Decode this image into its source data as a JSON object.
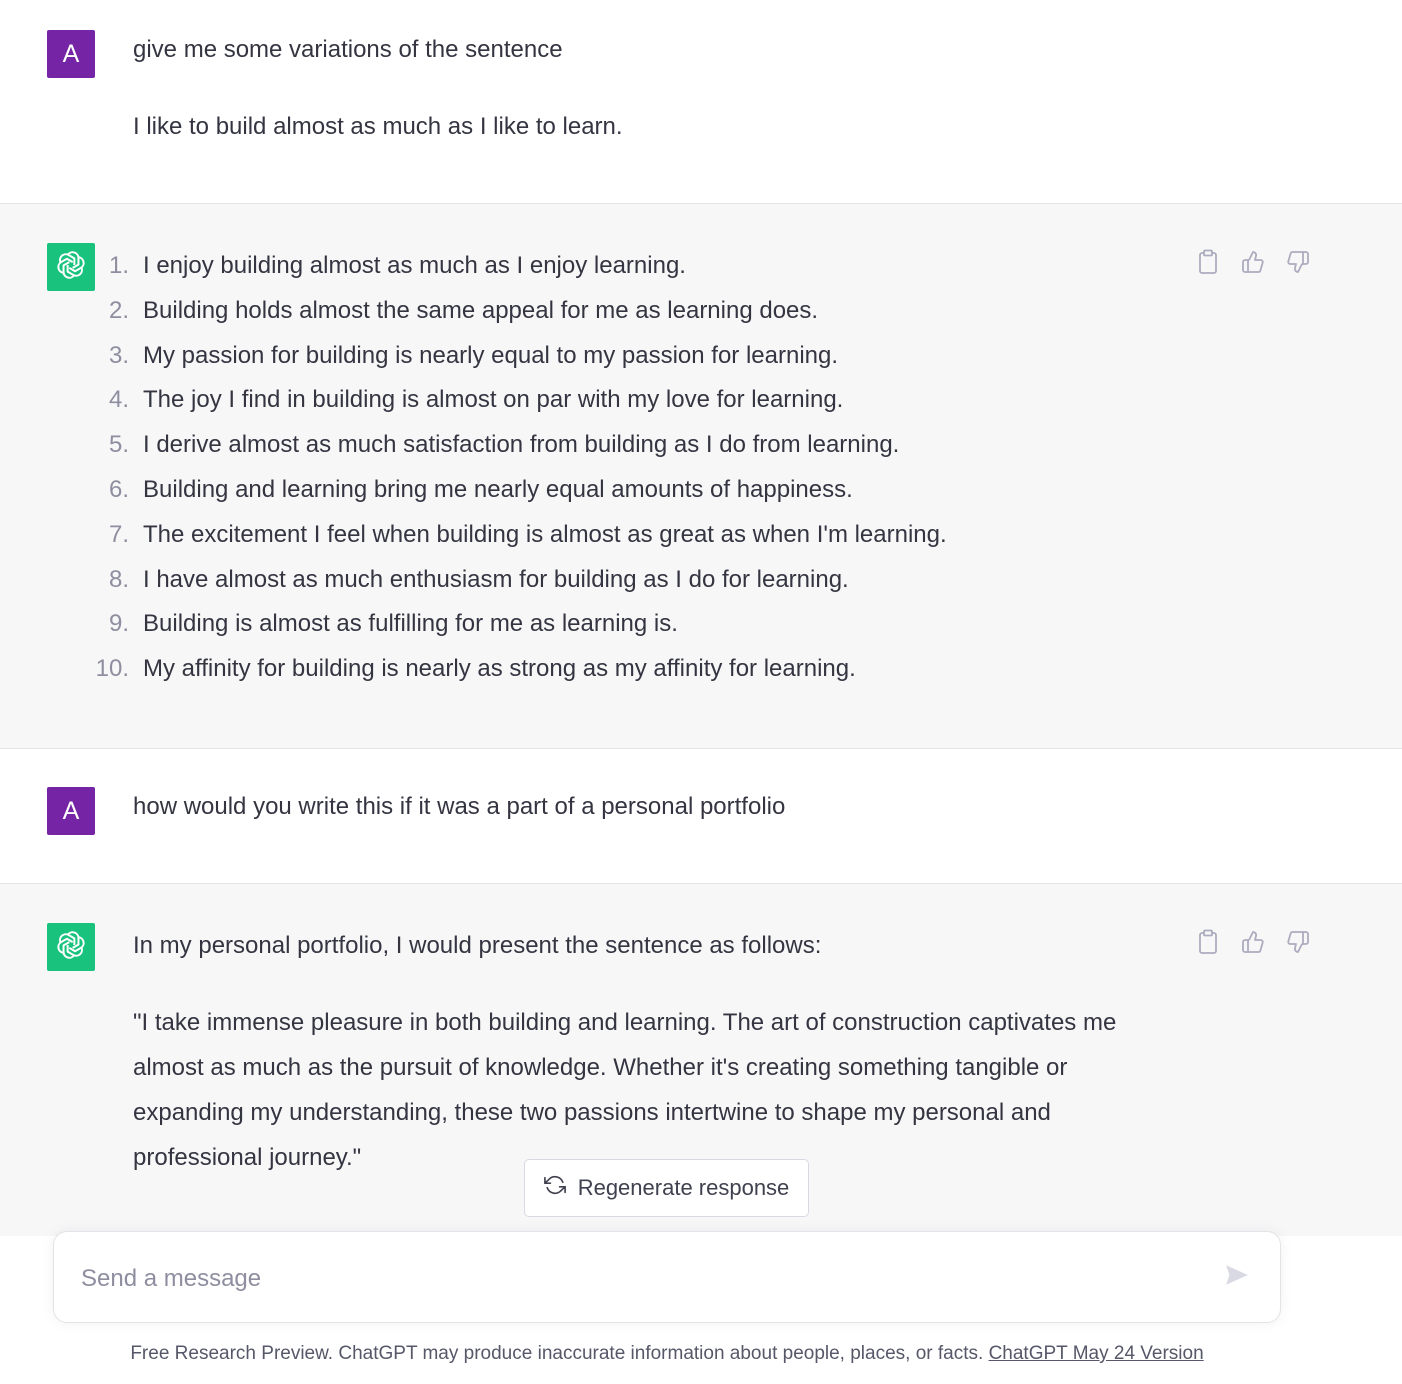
{
  "conversation": {
    "msg1": {
      "avatar_letter": "A",
      "line1": "give me some variations of the sentence",
      "line2": "I like to build almost as much as I like to learn."
    },
    "msg2": {
      "items": [
        {
          "num": "1.",
          "text": "I enjoy building almost as much as I enjoy learning."
        },
        {
          "num": "2.",
          "text": "Building holds almost the same appeal for me as learning does."
        },
        {
          "num": "3.",
          "text": "My passion for building is nearly equal to my passion for learning."
        },
        {
          "num": "4.",
          "text": "The joy I find in building is almost on par with my love for learning."
        },
        {
          "num": "5.",
          "text": "I derive almost as much satisfaction from building as I do from learning."
        },
        {
          "num": "6.",
          "text": "Building and learning bring me nearly equal amounts of happiness."
        },
        {
          "num": "7.",
          "text": "The excitement I feel when building is almost as great as when I'm learning."
        },
        {
          "num": "8.",
          "text": "I have almost as much enthusiasm for building as I do for learning."
        },
        {
          "num": "9.",
          "text": "Building is almost as fulfilling for me as learning is."
        },
        {
          "num": "10.",
          "text": "My affinity for building is nearly as strong as my affinity for learning."
        }
      ]
    },
    "msg3": {
      "avatar_letter": "A",
      "text": "how would you write this if it was a part of a personal portfolio"
    },
    "msg4": {
      "intro": "In my personal portfolio, I would present the sentence as follows:",
      "quote": "\"I take immense pleasure in both building and learning. The art of construction captivates me almost as much as the pursuit of knowledge. Whether it's creating something tangible or expanding my understanding, these two passions intertwine to shape my personal and professional journey.\""
    }
  },
  "regenerate": {
    "label": "Regenerate response"
  },
  "composer": {
    "placeholder": "Send a message"
  },
  "footer": {
    "text": "Free Research Preview. ChatGPT may produce inaccurate information about people, places, or facts.",
    "link": "ChatGPT May 24 Version"
  },
  "colors": {
    "user_avatar": "#7424a4",
    "bot_avatar": "#19c37d",
    "assistant_bg": "#f7f7f8",
    "text": "#343541"
  },
  "icons": [
    "openai-logo-icon",
    "clipboard-icon",
    "thumbs-up-icon",
    "thumbs-down-icon",
    "refresh-icon",
    "send-icon"
  ]
}
